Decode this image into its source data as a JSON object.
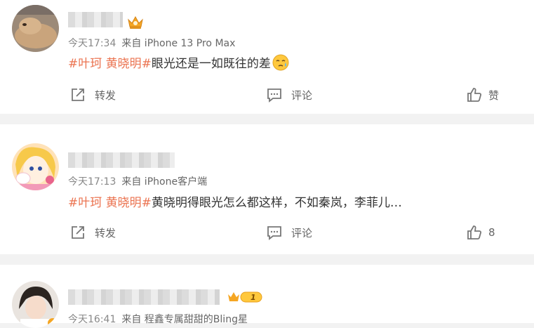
{
  "comments": [
    {
      "time": "今天17:34",
      "source": "来自 iPhone 13 Pro Max",
      "hashtag": "#叶珂 黄晓明#",
      "text": "眼光还是一如既往的差",
      "emoji": "crying-face-icon",
      "actions": {
        "repost": "转发",
        "comment": "评论",
        "like": "赞"
      }
    },
    {
      "time": "今天17:13",
      "source": "来自 iPhone客户端",
      "hashtag": "#叶珂 黄晓明#",
      "text": "黄晓明得眼光怎么都这样，不如秦岚，李菲儿…",
      "actions": {
        "repost": "转发",
        "comment": "评论",
        "like": "8"
      }
    },
    {
      "time": "今天16:41",
      "source": "来自 程鑫专属甜甜的Bling星",
      "level_badge": "1"
    }
  ],
  "colors": {
    "hashtag": "#eb7350",
    "meta": "#888888",
    "background": "#f2f2f2"
  }
}
